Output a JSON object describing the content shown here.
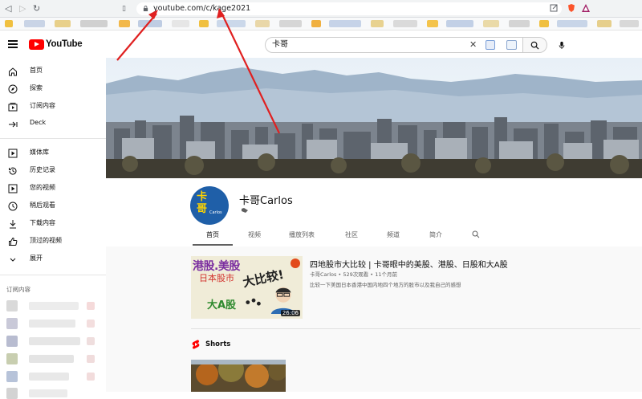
{
  "browser": {
    "url": "youtube.com/c/kage2021"
  },
  "youtube": {
    "logo_text": "YouTube",
    "search": {
      "value": "卡哥",
      "clear_glyph": "✕"
    }
  },
  "sidebar": {
    "items": [
      {
        "label": "首页",
        "icon": "home-icon"
      },
      {
        "label": "探索",
        "icon": "explore-icon"
      },
      {
        "label": "订阅内容",
        "icon": "subscriptions-icon"
      },
      {
        "label": "Deck",
        "icon": "deck-icon"
      },
      {
        "label": "媒体库",
        "icon": "library-icon"
      },
      {
        "label": "历史记录",
        "icon": "history-icon"
      },
      {
        "label": "您的视频",
        "icon": "your-videos-icon"
      },
      {
        "label": "稍后观看",
        "icon": "watch-later-icon"
      },
      {
        "label": "下载内容",
        "icon": "downloads-icon"
      },
      {
        "label": "顶过的视频",
        "icon": "liked-videos-icon"
      },
      {
        "label": "展开",
        "icon": "chevron-down-icon"
      }
    ],
    "subscriptions_heading": "订阅内容"
  },
  "channel": {
    "name": "卡哥Carlos",
    "avatar_text": "卡\n哥",
    "avatar_caption": "Carlos",
    "tabs": [
      "首页",
      "视频",
      "播放列表",
      "社区",
      "频道",
      "简介"
    ],
    "active_tab": 0
  },
  "featured_video": {
    "title": "四地股市大比较 | 卡哥眼中的美股、港股、日股和大A股",
    "meta": "卡哥Carlos • 529次观看 • 11个月前",
    "description": "比较一下美国日本香港中国内地四个地方的股市以及我自己的感想",
    "duration": "26:06",
    "thumb_text": {
      "line1": "港股.美股",
      "line2": "日本股市",
      "line3": "大比较!",
      "line4": "大A股"
    }
  },
  "shorts": {
    "label": "Shorts"
  },
  "colors": {
    "youtube_red": "#ff0000",
    "arrow_red": "#e02020",
    "avatar_blue": "#1f5fa8"
  }
}
